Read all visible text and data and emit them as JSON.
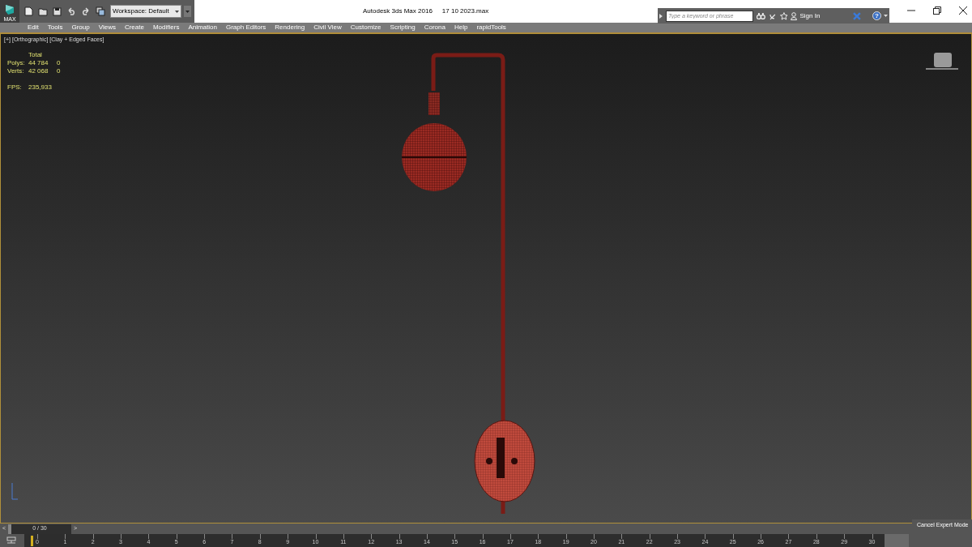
{
  "window": {
    "title": "Autodesk 3ds Max 2016",
    "file": "17 10 2023.max"
  },
  "app_button": {
    "label": "MAX"
  },
  "workspace": {
    "value": "Workspace: Default"
  },
  "search": {
    "placeholder": "Type a keyword or phrase"
  },
  "sign_in": {
    "label": "Sign In"
  },
  "help": {
    "label": "?"
  },
  "menu": [
    "Edit",
    "Tools",
    "Group",
    "Views",
    "Create",
    "Modifiers",
    "Animation",
    "Graph Editors",
    "Rendering",
    "Civil View",
    "Customize",
    "Scripting",
    "Corona",
    "Help",
    "rapidTools"
  ],
  "viewport": {
    "labels": [
      "[+]",
      "[Orthographic]",
      "[Clay + Edged Faces]"
    ],
    "stats": {
      "header": "Total",
      "rows": [
        {
          "label": "Polys:",
          "total": "44 784",
          "selected": "0"
        },
        {
          "label": "Verts:",
          "total": "42 068",
          "selected": "0"
        }
      ],
      "fps_label": "FPS:",
      "fps": "235,933"
    }
  },
  "time_slider": {
    "prev": "<",
    "frame": "0 / 30",
    "next": ">",
    "level": 0
  },
  "track_bar": {
    "ticks": [
      "0",
      "1",
      "2",
      "3",
      "4",
      "5",
      "6",
      "7",
      "8",
      "9",
      "10",
      "11",
      "12",
      "13",
      "14",
      "15",
      "16",
      "17",
      "18",
      "19",
      "20",
      "21",
      "22",
      "23",
      "24",
      "25",
      "26",
      "27",
      "28",
      "29",
      "30"
    ]
  },
  "status": {
    "button": "Cancel Expert Mode"
  }
}
